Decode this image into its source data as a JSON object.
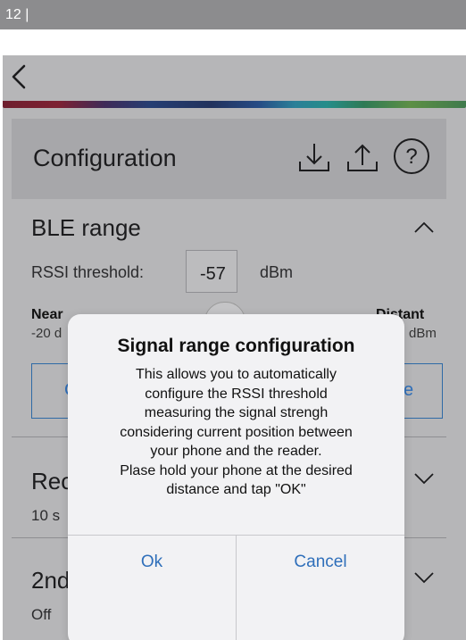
{
  "doc_header": {
    "text": "12 |"
  },
  "nav": {
    "back_icon": "chevron-left-icon"
  },
  "config": {
    "title": "Configuration",
    "icons": [
      "download-icon",
      "upload-icon",
      "help-icon"
    ],
    "help_glyph": "?"
  },
  "ble": {
    "title": "BLE range",
    "rssi_label": "RSSI threshold:",
    "rssi_value": "-57",
    "rssi_unit": "dBm",
    "near_label": "Near",
    "near_sub": "-20 d",
    "distant_label": "Distant",
    "distant_sub": "dBm",
    "btn_left_fragment": "C",
    "btn_right_fragment": "e"
  },
  "section2": {
    "title_fragment": "Rec",
    "value_fragment": "10 s"
  },
  "section3": {
    "title_fragment": "2nd",
    "value": "Off"
  },
  "dialog": {
    "title": "Signal range configuration",
    "message_lines": [
      "This allows you to automatically",
      "configure the RSSI threshold",
      "measuring the signal strengh",
      "considering current position between",
      "your phone and the reader.",
      "Plase hold your phone at the desired",
      "distance and tap \"OK\""
    ],
    "ok_label": "Ok",
    "cancel_label": "Cancel"
  },
  "colors": {
    "accent": "#2f6fba",
    "background": "#b6b6b8",
    "dialog": "#f2f2f4"
  }
}
